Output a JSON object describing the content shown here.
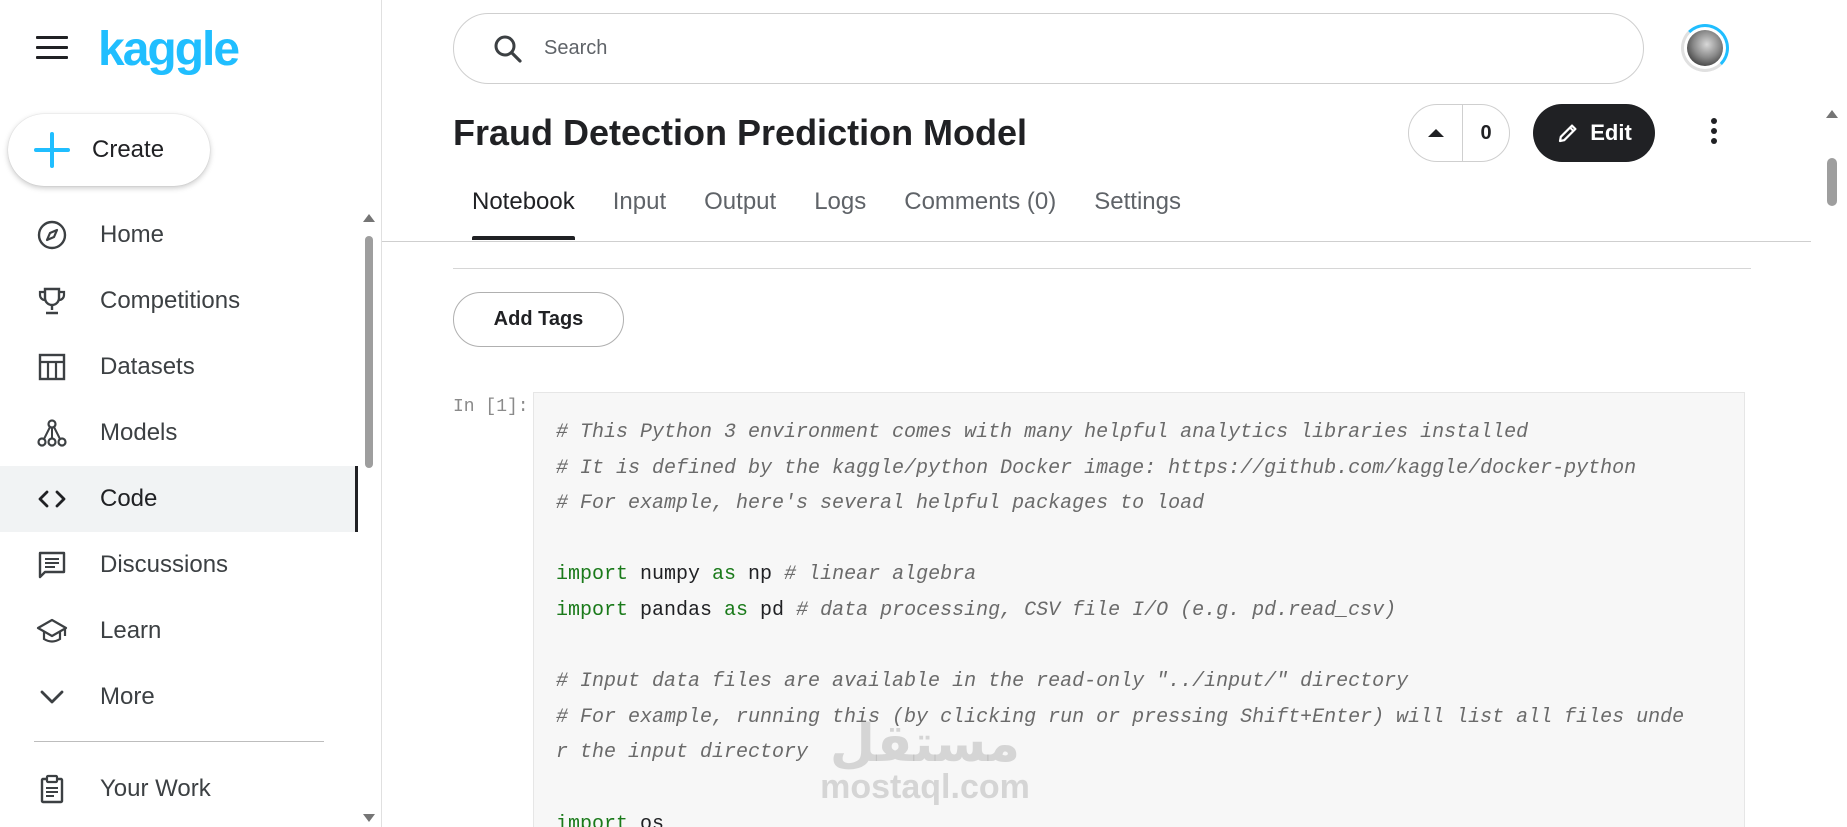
{
  "brand": {
    "logo_text": "kaggle",
    "accent": "#20beff"
  },
  "sidebar": {
    "create_label": "Create",
    "items": [
      {
        "label": "Home",
        "icon": "compass-icon"
      },
      {
        "label": "Competitions",
        "icon": "trophy-icon"
      },
      {
        "label": "Datasets",
        "icon": "table-icon"
      },
      {
        "label": "Models",
        "icon": "models-icon"
      },
      {
        "label": "Code",
        "icon": "code-icon",
        "active": true
      },
      {
        "label": "Discussions",
        "icon": "comment-icon"
      },
      {
        "label": "Learn",
        "icon": "school-icon"
      },
      {
        "label": "More",
        "icon": "chevron-down-icon"
      }
    ],
    "your_work": {
      "label": "Your Work",
      "icon": "clipboard-icon"
    }
  },
  "header": {
    "search_placeholder": "Search"
  },
  "notebook": {
    "title": "Fraud Detection Prediction Model",
    "vote_count": "0",
    "edit_label": "Edit",
    "tabs": [
      "Notebook",
      "Input",
      "Output",
      "Logs",
      "Comments (0)",
      "Settings"
    ],
    "active_tab": "Notebook",
    "add_tags_label": "Add Tags",
    "cell_prompt": "In [1]:",
    "code_lines": [
      {
        "parts": [
          {
            "t": "# This Python 3 environment comes with many helpful analytics libraries installed",
            "c": "cmt"
          }
        ]
      },
      {
        "parts": [
          {
            "t": "# It is defined by the kaggle/python Docker image: https://github.com/kaggle/docker-python",
            "c": "cmt"
          }
        ]
      },
      {
        "parts": [
          {
            "t": "# For example, here's several helpful packages to load",
            "c": "cmt"
          }
        ]
      },
      {
        "parts": []
      },
      {
        "parts": [
          {
            "t": "import",
            "c": "kw"
          },
          {
            "t": " numpy ",
            "c": ""
          },
          {
            "t": "as",
            "c": "kw"
          },
          {
            "t": " np ",
            "c": ""
          },
          {
            "t": "# linear algebra",
            "c": "cmt"
          }
        ]
      },
      {
        "parts": [
          {
            "t": "import",
            "c": "kw"
          },
          {
            "t": " pandas ",
            "c": ""
          },
          {
            "t": "as",
            "c": "kw"
          },
          {
            "t": " pd ",
            "c": ""
          },
          {
            "t": "# data processing, CSV file I/O (e.g. pd.read_csv)",
            "c": "cmt"
          }
        ]
      },
      {
        "parts": []
      },
      {
        "parts": [
          {
            "t": "# Input data files are available in the read-only \"../input/\" directory",
            "c": "cmt"
          }
        ]
      },
      {
        "parts": [
          {
            "t": "# For example, running this (by clicking run or pressing Shift+Enter) will list all files unde",
            "c": "cmt"
          }
        ]
      },
      {
        "parts": [
          {
            "t": "r the input directory",
            "c": "cmt"
          }
        ]
      },
      {
        "parts": []
      },
      {
        "parts": [
          {
            "t": "import",
            "c": "kw"
          },
          {
            "t": " os",
            "c": ""
          }
        ]
      }
    ]
  },
  "watermark": {
    "arabic": "مستقل",
    "latin": "mostaql.com"
  }
}
